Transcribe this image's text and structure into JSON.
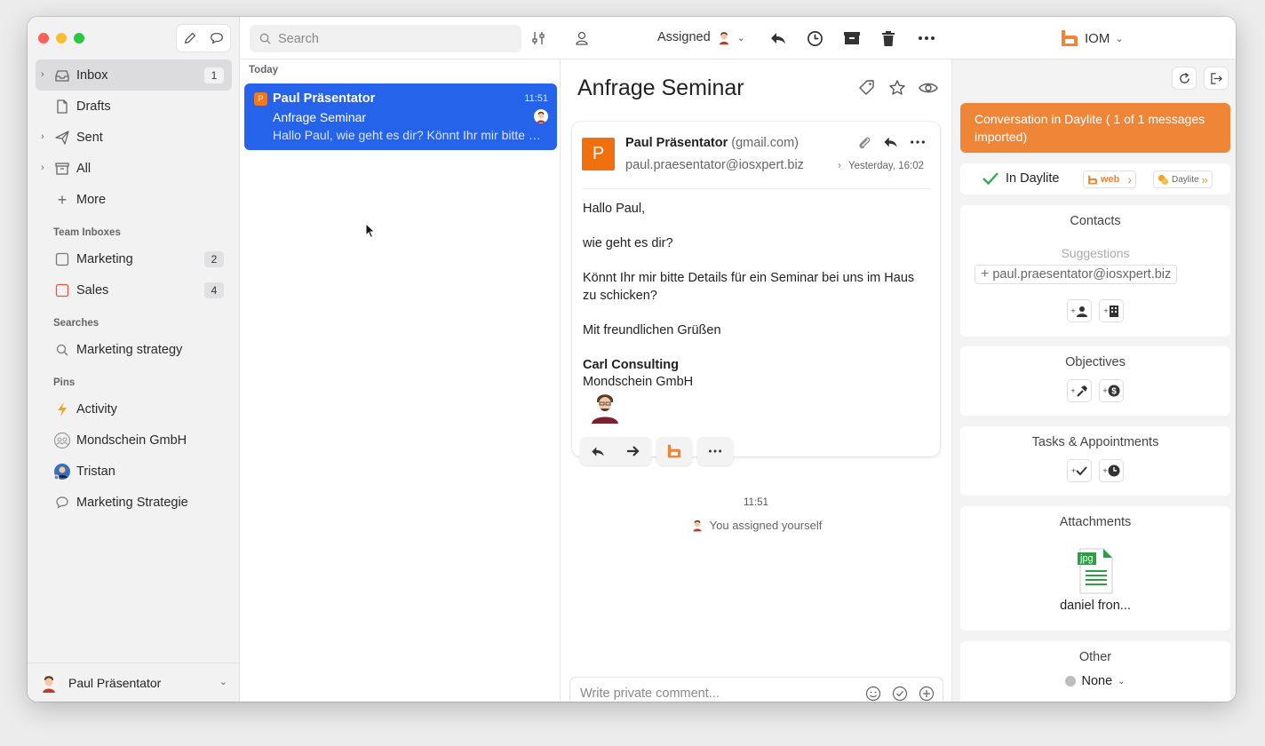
{
  "sidebar": {
    "nav": [
      {
        "label": "Inbox",
        "badge": "1",
        "icon": "inbox-icon"
      },
      {
        "label": "Drafts",
        "icon": "document-icon"
      },
      {
        "label": "Sent",
        "icon": "send-icon"
      },
      {
        "label": "All",
        "icon": "archive-icon"
      },
      {
        "label": "More",
        "icon": "plus-icon"
      }
    ],
    "team_inboxes_heading": "Team Inboxes",
    "team_inboxes": [
      {
        "label": "Marketing",
        "badge": "2"
      },
      {
        "label": "Sales",
        "badge": "4"
      }
    ],
    "searches_heading": "Searches",
    "searches": [
      {
        "label": "Marketing strategy"
      }
    ],
    "pins_heading": "Pins",
    "pins": [
      {
        "label": "Activity"
      },
      {
        "label": "Mondschein GmbH"
      },
      {
        "label": "Tristan"
      },
      {
        "label": "Marketing Strategie"
      }
    ],
    "user_name": "Paul Präsentator"
  },
  "toolbar": {
    "search_placeholder": "Search",
    "assigned_label": "Assigned",
    "account_label": "IOM"
  },
  "list": {
    "date_heading": "Today",
    "messages": [
      {
        "badge": "P",
        "from": "Paul Präsentator",
        "time": "11:51",
        "subject": "Anfrage Seminar",
        "preview": "Hallo Paul, wie geht es dir? Könnt Ihr mir bitte Details für ein Seminar bei uns im Haus zu schicken?"
      }
    ]
  },
  "conversation": {
    "title": "Anfrage Seminar",
    "email": {
      "avatar_letter": "P",
      "from_name": "Paul Präsentator",
      "from_domain": "(gmail.com)",
      "address": "paul.praesentator@iosxpert.biz",
      "date": "Yesterday, 16:02",
      "body": {
        "greeting": "Hallo Paul,",
        "line1": "wie geht es dir?",
        "line2": "Könnt Ihr mir bitte Details für ein Seminar bei uns im Haus zu schicken?",
        "closing": "Mit freundlichen Grüßen",
        "sig_name": "Carl Consulting",
        "sig_company": "Mondschein GmbH"
      }
    },
    "event_time": "11:51",
    "event_text": "You assigned yourself",
    "comment_placeholder": "Write private comment..."
  },
  "panel": {
    "banner": "Conversation in Daylite ( 1 of 1 messages imported)",
    "in_daylite_label": "In Daylite",
    "logo1_text": "web",
    "logo2_text": "Daylite",
    "contacts_heading": "Contacts",
    "suggestions_label": "Suggestions",
    "suggestion_email": "paul.praesentator@iosxpert.biz",
    "objectives_heading": "Objectives",
    "tasks_heading": "Tasks & Appointments",
    "attachments_heading": "Attachments",
    "attachment_ext": "jpg",
    "attachment_name": "daniel fron...",
    "other_heading": "Other",
    "other_value": "None"
  },
  "colors": {
    "selected_row": "#2563eb",
    "banner": "#ef8537",
    "avatar": "#f07010",
    "daylite_check": "#34a853"
  }
}
